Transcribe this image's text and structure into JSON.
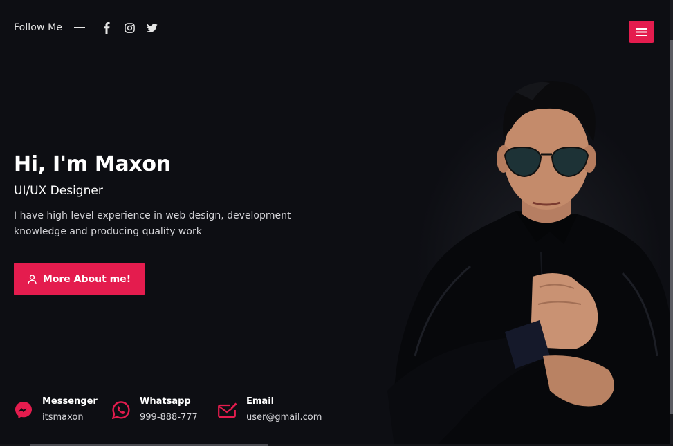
{
  "header": {
    "follow_label": "Follow Me",
    "social": [
      {
        "name": "facebook-icon"
      },
      {
        "name": "instagram-icon"
      },
      {
        "name": "twitter-icon"
      }
    ],
    "menu_icon": "hamburger-menu-icon"
  },
  "hero": {
    "title": "Hi, I'm Maxon",
    "subtitle": "UI/UX Designer",
    "description": "I have high level experience in web design, development knowledge and producing quality work",
    "cta_label": "More About me!",
    "cta_icon": "user-icon"
  },
  "contacts": [
    {
      "icon": "messenger-icon",
      "title": "Messenger",
      "value": "itsmaxon"
    },
    {
      "icon": "whatsapp-icon",
      "title": "Whatsapp",
      "value": "999-888-777"
    },
    {
      "icon": "email-icon",
      "title": "Email",
      "value": "user@gmail.com"
    }
  ],
  "colors": {
    "background": "#0d0e13",
    "accent": "#e41c4e",
    "text": "#ffffff",
    "muted_text": "#d4d4d8"
  }
}
